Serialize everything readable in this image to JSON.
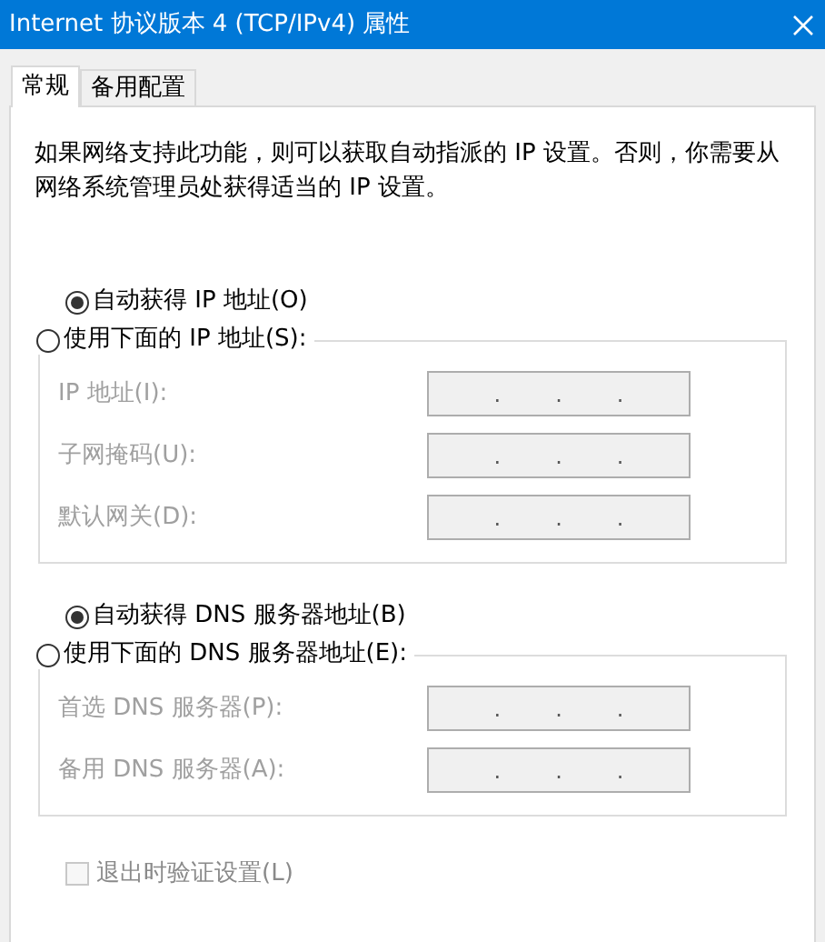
{
  "window": {
    "title": "Internet 协议版本 4 (TCP/IPv4) 属性"
  },
  "tabs": [
    {
      "label": "常规",
      "selected": true
    },
    {
      "label": "备用配置",
      "selected": false
    }
  ],
  "description": "如果网络支持此功能，则可以获取自动指派的 IP 设置。否则，你需要从网络系统管理员处获得适当的 IP 设置。",
  "ip": {
    "options": [
      {
        "label": "自动获得 IP 地址(O)",
        "selected": true
      },
      {
        "label": "使用下面的 IP 地址(S):",
        "selected": false
      }
    ],
    "fields": [
      {
        "label": "IP 地址(I):",
        "disabled": true,
        "separators": [
          ".",
          ".",
          "."
        ]
      },
      {
        "label": "子网掩码(U):",
        "disabled": true,
        "separators": [
          ".",
          ".",
          "."
        ]
      },
      {
        "label": "默认网关(D):",
        "disabled": true,
        "separators": [
          ".",
          ".",
          "."
        ]
      }
    ]
  },
  "dns": {
    "options": [
      {
        "label": "自动获得 DNS 服务器地址(B)",
        "selected": true
      },
      {
        "label": "使用下面的 DNS 服务器地址(E):",
        "selected": false
      }
    ],
    "fields": [
      {
        "label": "首选 DNS 服务器(P):",
        "disabled": true,
        "separators": [
          ".",
          ".",
          "."
        ]
      },
      {
        "label": "备用 DNS 服务器(A):",
        "disabled": true,
        "separators": [
          ".",
          ".",
          "."
        ]
      }
    ]
  },
  "validate": {
    "label": "退出时验证设置(L)",
    "checked": false,
    "disabled": true
  }
}
